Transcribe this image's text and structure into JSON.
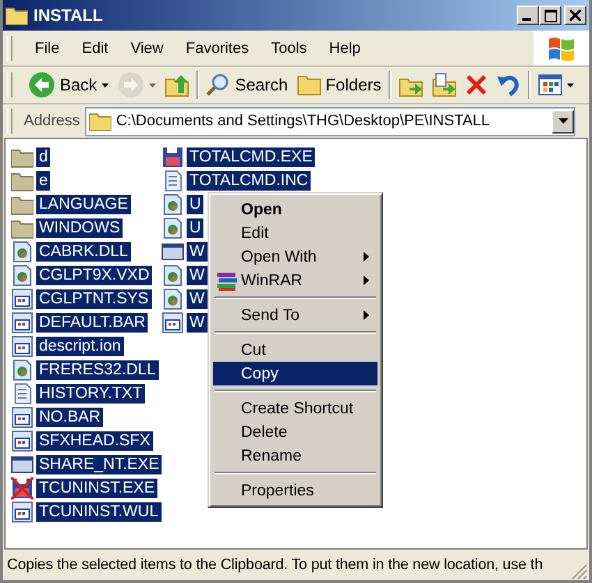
{
  "window": {
    "title": "INSTALL"
  },
  "menu_bar": [
    "File",
    "Edit",
    "View",
    "Favorites",
    "Tools",
    "Help"
  ],
  "toolbar": [
    {
      "kind": "back",
      "label": "Back",
      "disabled": false
    },
    {
      "kind": "forward",
      "disabled": true
    },
    {
      "kind": "up",
      "disabled": false
    },
    {
      "kind": "search",
      "label": "Search",
      "disabled": false
    },
    {
      "kind": "folders",
      "label": "Folders",
      "disabled": false
    },
    {
      "kind": "move",
      "disabled": false
    },
    {
      "kind": "copy",
      "disabled": false
    },
    {
      "kind": "delete",
      "disabled": false
    },
    {
      "kind": "undo",
      "disabled": false
    },
    {
      "kind": "views",
      "disabled": false
    }
  ],
  "address": {
    "label": "Address",
    "value": "C:\\Documents and Settings\\THG\\Desktop\\PE\\INSTALL"
  },
  "files": [
    {
      "name": "d",
      "kind": "folder",
      "selected": true
    },
    {
      "name": "e",
      "kind": "folder",
      "selected": true
    },
    {
      "name": "LANGUAGE",
      "kind": "folder",
      "selected": true
    },
    {
      "name": "WINDOWS",
      "kind": "folder",
      "selected": true
    },
    {
      "name": "CABRK.DLL",
      "kind": "dll",
      "selected": true
    },
    {
      "name": "CGLPT9X.VXD",
      "kind": "dll",
      "selected": true
    },
    {
      "name": "CGLPTNT.SYS",
      "kind": "app",
      "selected": true
    },
    {
      "name": "DEFAULT.BAR",
      "kind": "app",
      "selected": true
    },
    {
      "name": "descript.ion",
      "kind": "app",
      "selected": true
    },
    {
      "name": "FRERES32.DLL",
      "kind": "dll",
      "selected": true
    },
    {
      "name": "HISTORY.TXT",
      "kind": "text",
      "selected": true
    },
    {
      "name": "NO.BAR",
      "kind": "app",
      "selected": true
    },
    {
      "name": "SFXHEAD.SFX",
      "kind": "app",
      "selected": true
    },
    {
      "name": "SHARE_NT.EXE",
      "kind": "window",
      "selected": true
    },
    {
      "name": "TCUNINST.EXE",
      "kind": "floppy-x",
      "selected": true
    },
    {
      "name": "TCUNINST.WUL",
      "kind": "app",
      "selected": true
    },
    {
      "name": "TOTALCMD.EXE",
      "kind": "floppy",
      "selected": true
    },
    {
      "name": "TOTALCMD.INC",
      "kind": "text",
      "selected": true
    },
    {
      "name": "U",
      "kind": "dll",
      "selected": true
    },
    {
      "name": "U",
      "kind": "dll",
      "selected": true
    },
    {
      "name": "W",
      "kind": "window",
      "selected": true
    },
    {
      "name": "W",
      "kind": "dll",
      "selected": true
    },
    {
      "name": "W",
      "kind": "dll",
      "selected": true
    },
    {
      "name": "W",
      "kind": "app",
      "selected": true
    }
  ],
  "context_menu": [
    {
      "kind": "item",
      "label": "Open",
      "default": true,
      "submenu": false,
      "selected": false,
      "icon": false
    },
    {
      "kind": "item",
      "label": "Edit",
      "default": false,
      "submenu": false,
      "selected": false,
      "icon": false
    },
    {
      "kind": "item",
      "label": "Open With",
      "default": false,
      "submenu": true,
      "selected": false,
      "icon": false
    },
    {
      "kind": "item",
      "label": "WinRAR",
      "default": false,
      "submenu": true,
      "selected": false,
      "icon": true
    },
    {
      "kind": "separator"
    },
    {
      "kind": "item",
      "label": "Send To",
      "default": false,
      "submenu": true,
      "selected": false,
      "icon": false
    },
    {
      "kind": "separator"
    },
    {
      "kind": "item",
      "label": "Cut",
      "default": false,
      "submenu": false,
      "selected": false,
      "icon": false
    },
    {
      "kind": "item",
      "label": "Copy",
      "default": false,
      "submenu": false,
      "selected": true,
      "icon": false
    },
    {
      "kind": "separator"
    },
    {
      "kind": "item",
      "label": "Create Shortcut",
      "default": false,
      "submenu": false,
      "selected": false,
      "icon": false
    },
    {
      "kind": "item",
      "label": "Delete",
      "default": false,
      "submenu": false,
      "selected": false,
      "icon": false
    },
    {
      "kind": "item",
      "label": "Rename",
      "default": false,
      "submenu": false,
      "selected": false,
      "icon": false
    },
    {
      "kind": "separator"
    },
    {
      "kind": "item",
      "label": "Properties",
      "default": false,
      "submenu": false,
      "selected": false,
      "icon": false
    }
  ],
  "status_bar": "Copies the selected items to the Clipboard. To put them in the new location, use th"
}
